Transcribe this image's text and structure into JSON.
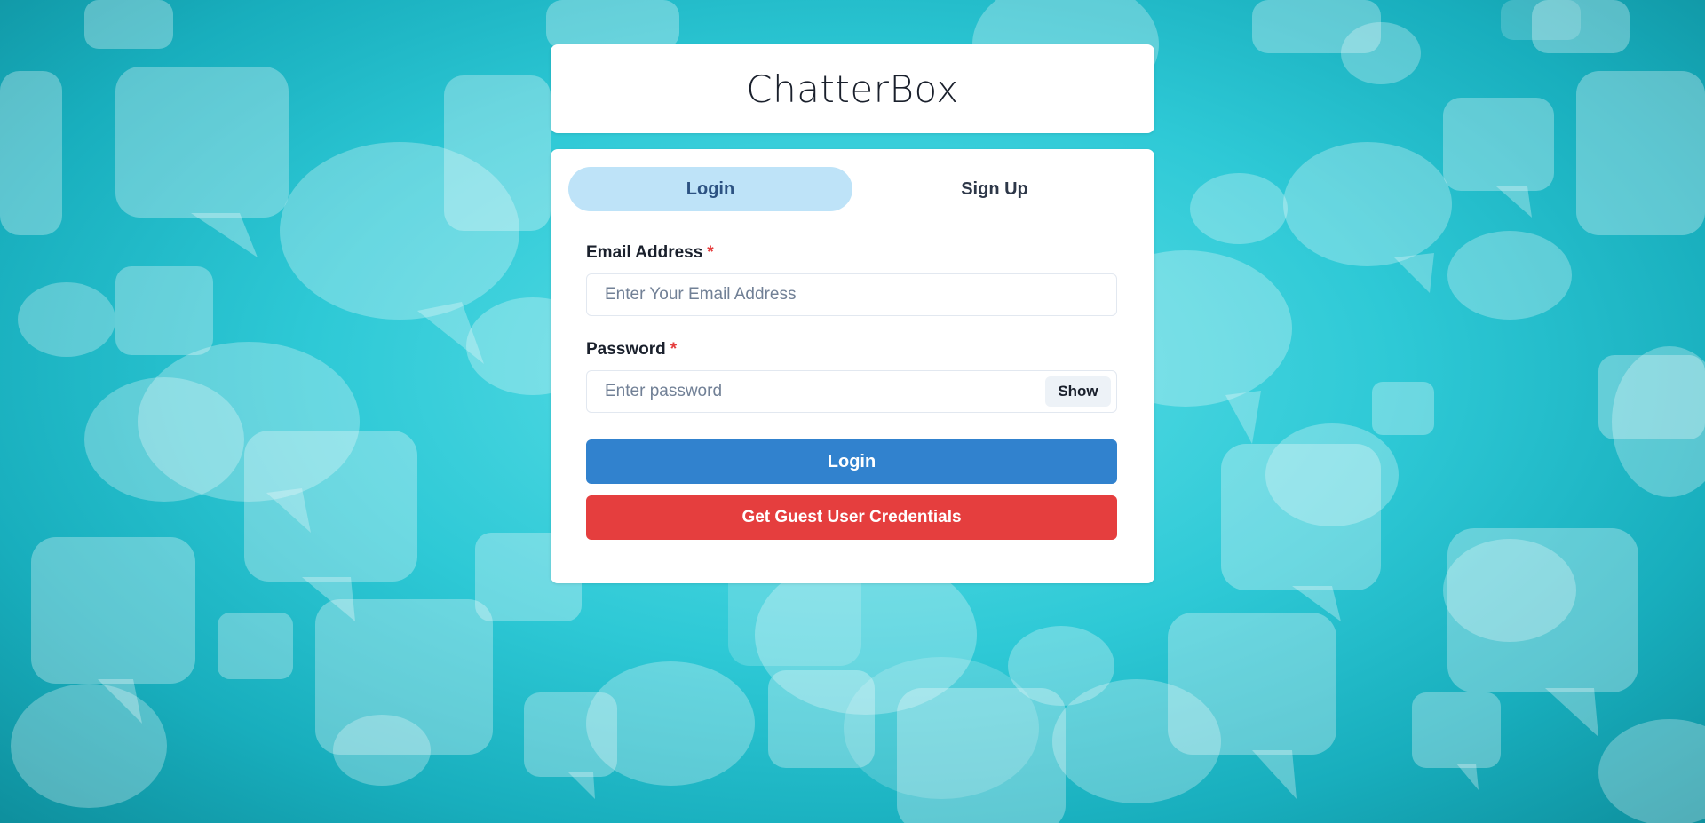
{
  "app": {
    "title": "ChatterBox"
  },
  "tabs": [
    {
      "label": "Login",
      "active": true
    },
    {
      "label": "Sign Up",
      "active": false
    }
  ],
  "form": {
    "email": {
      "label": "Email Address",
      "required_marker": "*",
      "placeholder": "Enter Your Email Address",
      "value": ""
    },
    "password": {
      "label": "Password",
      "required_marker": "*",
      "placeholder": "Enter password",
      "value": "",
      "toggle_label": "Show"
    },
    "login_button": "Login",
    "guest_button": "Get Guest User Credentials"
  },
  "background": {
    "pattern": "speech-bubbles",
    "base_color": "#2ec9d6"
  },
  "colors": {
    "primary": "#3182ce",
    "danger": "#e53e3e",
    "active_tab": "#bee3f8"
  }
}
